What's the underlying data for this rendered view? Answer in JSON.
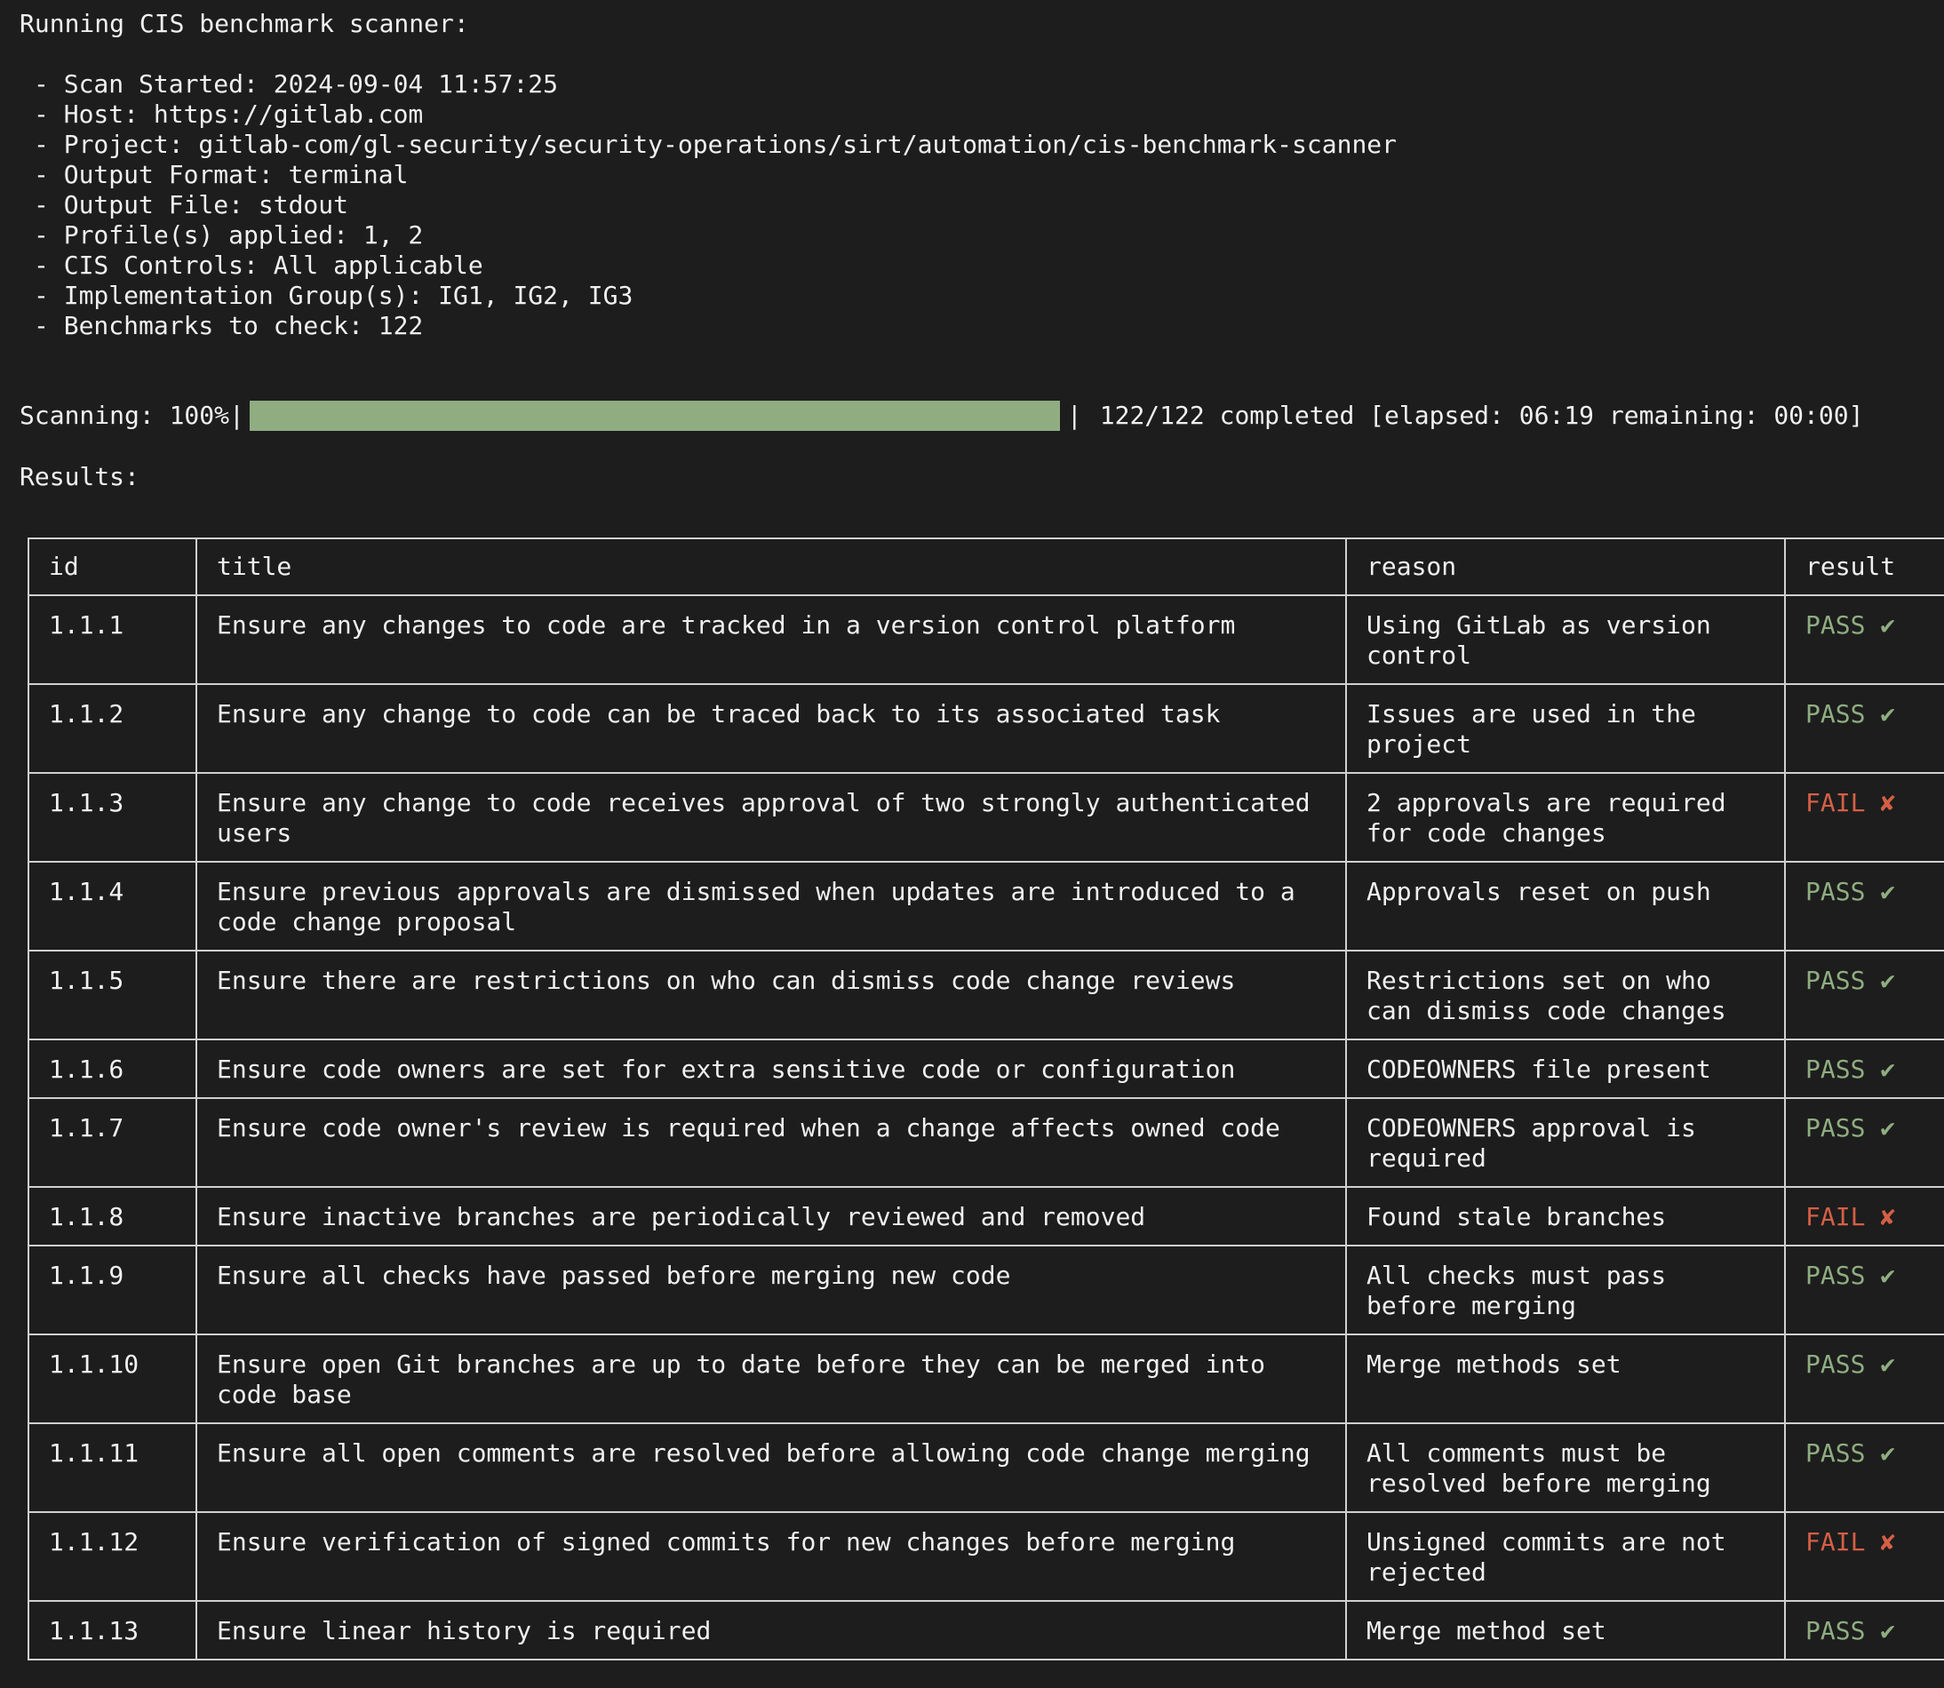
{
  "header": {
    "running": "Running CIS benchmark scanner:",
    "details": [
      "- Scan Started: 2024-09-04 11:57:25",
      "- Host: https://gitlab.com",
      "- Project: gitlab-com/gl-security/security-operations/sirt/automation/cis-benchmark-scanner",
      "- Output Format: terminal",
      "- Output File: stdout",
      "- Profile(s) applied: 1, 2",
      "- CIS Controls: All applicable",
      "- Implementation Group(s): IG1, IG2, IG3",
      "- Benchmarks to check: 122"
    ]
  },
  "progress": {
    "label": "Scanning: 100%",
    "fraction": 1.0,
    "status": "122/122 completed [elapsed: 06:19 remaining: 00:00]",
    "bar_color": "#8fad81"
  },
  "results_label": "Results:",
  "table": {
    "columns": [
      "id",
      "title",
      "reason",
      "result"
    ],
    "rows": [
      {
        "id": "1.1.1",
        "title": "Ensure any changes to code are tracked in a version control platform",
        "reason": "Using GitLab as version control",
        "result": "PASS ✔",
        "status": "pass"
      },
      {
        "id": "1.1.2",
        "title": "Ensure any change to code can be traced back to its associated task",
        "reason": "Issues are used in the project",
        "result": "PASS ✔",
        "status": "pass"
      },
      {
        "id": "1.1.3",
        "title": "Ensure any change to code receives approval of two strongly authenticated users",
        "reason": "2 approvals are required for code changes",
        "result": "FAIL ✘",
        "status": "fail"
      },
      {
        "id": "1.1.4",
        "title": "Ensure previous approvals are dismissed when updates are introduced to a code change proposal",
        "reason": "Approvals reset on push",
        "result": "PASS ✔",
        "status": "pass"
      },
      {
        "id": "1.1.5",
        "title": "Ensure there are restrictions on who can dismiss code change reviews",
        "reason": "Restrictions set on who can dismiss code changes",
        "result": "PASS ✔",
        "status": "pass"
      },
      {
        "id": "1.1.6",
        "title": "Ensure code owners are set for extra sensitive code or configuration",
        "reason": "CODEOWNERS file present",
        "result": "PASS ✔",
        "status": "pass"
      },
      {
        "id": "1.1.7",
        "title": "Ensure code owner's review is required when a change affects owned code",
        "reason": "CODEOWNERS approval is required",
        "result": "PASS ✔",
        "status": "pass"
      },
      {
        "id": "1.1.8",
        "title": "Ensure inactive branches are periodically reviewed and removed",
        "reason": "Found stale branches",
        "result": "FAIL ✘",
        "status": "fail"
      },
      {
        "id": "1.1.9",
        "title": "Ensure all checks have passed before merging new code",
        "reason": "All checks must pass before merging",
        "result": "PASS ✔",
        "status": "pass"
      },
      {
        "id": "1.1.10",
        "title": "Ensure open Git branches are up to date before they can be merged into code base",
        "reason": "Merge methods set",
        "result": "PASS ✔",
        "status": "pass"
      },
      {
        "id": "1.1.11",
        "title": "Ensure all open comments are resolved before allowing code change merging",
        "reason": "All comments must be resolved before merging",
        "result": "PASS ✔",
        "status": "pass"
      },
      {
        "id": "1.1.12",
        "title": "Ensure verification of signed commits for new changes before merging",
        "reason": "Unsigned commits are not rejected",
        "result": "FAIL ✘",
        "status": "fail"
      },
      {
        "id": "1.1.13",
        "title": "Ensure linear history is required",
        "reason": "Merge method set",
        "result": "PASS ✔",
        "status": "pass"
      }
    ]
  }
}
